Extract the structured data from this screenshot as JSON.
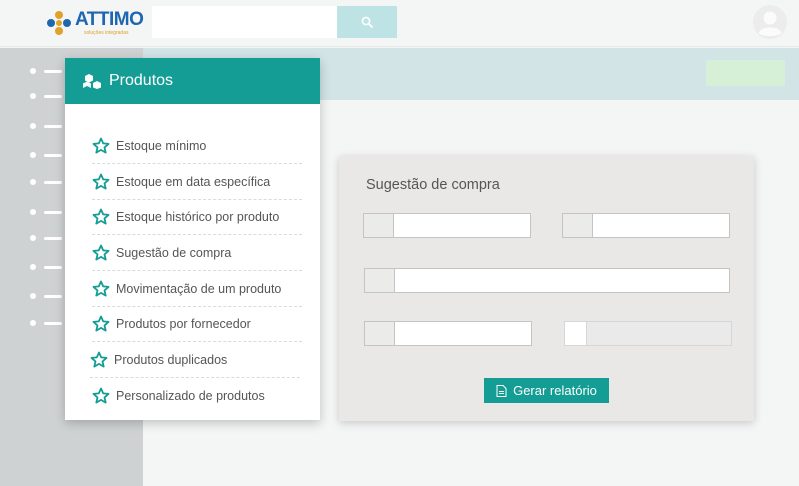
{
  "brand": {
    "name": "ATTIMO",
    "tagline": "soluções integradas"
  },
  "search": {
    "placeholder": "",
    "icon": "search-icon"
  },
  "user": {
    "icon": "user-avatar-icon"
  },
  "rail": {
    "items": 10
  },
  "menu": {
    "title": "Produtos",
    "icon": "products-cubes-icon",
    "items": [
      {
        "label": "Estoque mínimo",
        "icon": "star-icon"
      },
      {
        "label": "Estoque em data específica",
        "icon": "star-icon"
      },
      {
        "label": "Estoque histórico por produto",
        "icon": "star-icon"
      },
      {
        "label": "Sugestão de compra",
        "icon": "star-icon"
      },
      {
        "label": "Movimentação de um produto",
        "icon": "star-icon"
      },
      {
        "label": "Produtos por fornecedor",
        "icon": "star-icon"
      },
      {
        "label": "Produtos duplicados",
        "icon": "star-icon"
      },
      {
        "label": "Personalizado de produtos",
        "icon": "star-icon"
      }
    ]
  },
  "form": {
    "title": "Sugestão de compra",
    "fields": [
      {
        "value": "",
        "disabled": false
      },
      {
        "value": "",
        "disabled": false
      },
      {
        "value": "",
        "disabled": false
      },
      {
        "value": "",
        "disabled": false
      },
      {
        "value": "",
        "disabled": true
      }
    ],
    "submit_label": "Gerar relatório"
  },
  "colors": {
    "primary": "#149d94",
    "brand_blue": "#1f66b0",
    "brand_orange": "#e0a22a",
    "rail": "#cfd2d3",
    "band": "#d2e4e6"
  }
}
